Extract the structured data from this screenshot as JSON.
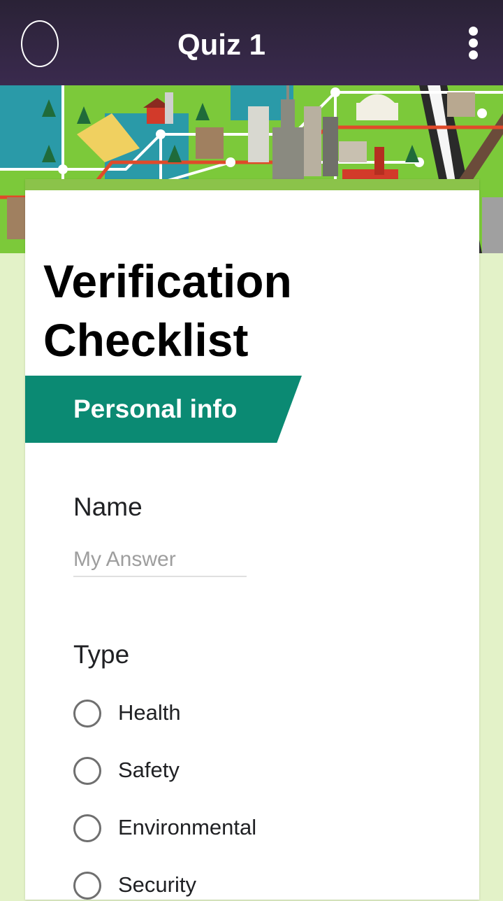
{
  "app_bar": {
    "title": "Quiz 1",
    "avatar_icon": "avatar-outline-icon",
    "menu_icon": "more-vert-icon"
  },
  "banner": {
    "icon": "city-map-illustration"
  },
  "form": {
    "title": "Verification Checklist",
    "section": {
      "label": "Personal info"
    },
    "questions": [
      {
        "label": "Name",
        "type": "short-answer",
        "placeholder": "My Answer",
        "value": ""
      },
      {
        "label": "Type",
        "type": "radio",
        "options": [
          "Health",
          "Safety",
          "Environmental",
          "Security"
        ]
      }
    ]
  },
  "colors": {
    "app_bar": "#2f2540",
    "section_header": "#0b8a73",
    "card_accent": "#8bc34a",
    "page_background": "#e3f2c8"
  }
}
